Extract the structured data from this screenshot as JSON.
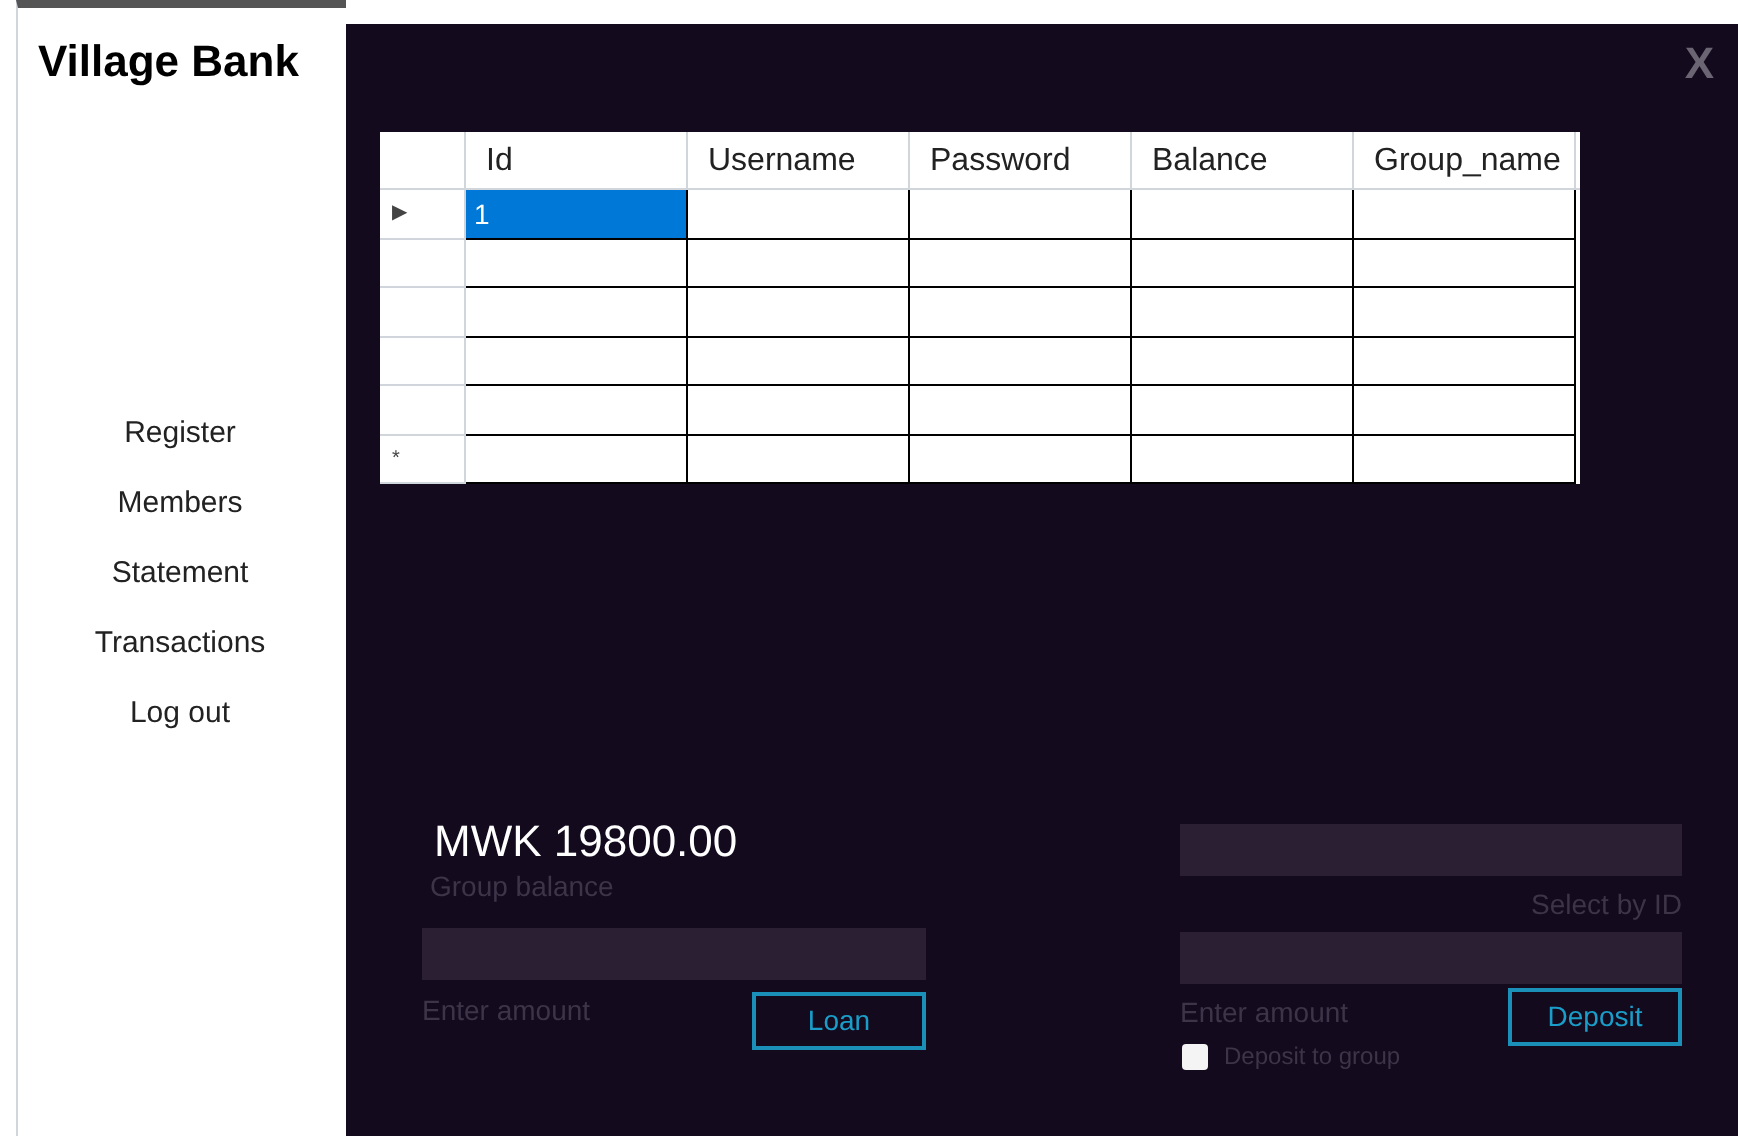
{
  "sidebar": {
    "title": "Village Bank",
    "items": [
      "Register",
      "Members",
      "Statement",
      "Transactions",
      "Log out"
    ]
  },
  "window": {
    "close": "X"
  },
  "table": {
    "columns": [
      "Id",
      "Username",
      "Password",
      "Balance",
      "Group_name"
    ],
    "rows": [
      {
        "marker": "▶",
        "id": "1",
        "selected": true
      },
      {
        "selected": false
      },
      {
        "selected": false
      },
      {
        "selected": false
      },
      {
        "selected": false
      },
      {
        "marker": "*",
        "selected": false
      }
    ]
  },
  "loan": {
    "balance": "MWK 19800.00",
    "balance_label": "Group balance",
    "amount_label": "Enter amount",
    "button": "Loan"
  },
  "deposit": {
    "id_label": "Select by ID",
    "amount_label": "Enter amount",
    "checkbox": {
      "label": "Deposit to group",
      "checked": false
    },
    "button": "Deposit"
  }
}
